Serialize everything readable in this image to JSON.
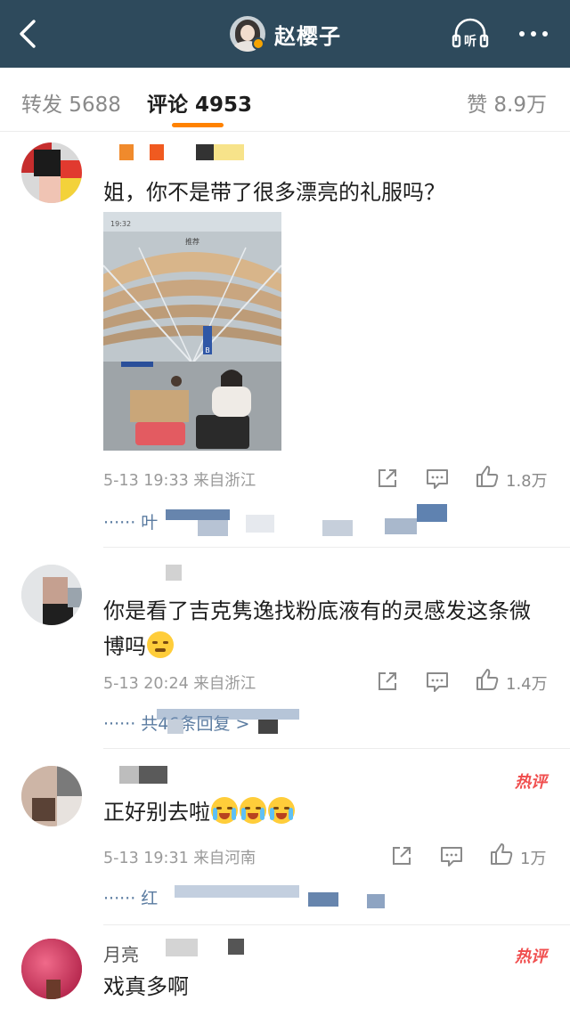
{
  "header": {
    "title": "赵樱子",
    "back_icon": "chevron-left-icon",
    "listen_label": "听",
    "more_icon": "more-dots-icon",
    "bg_color": "#2e4a5c"
  },
  "tabs": {
    "repost": "转发 5688",
    "comment": "评论 4953",
    "like": "赞 8.9万",
    "accent_color": "#ff8200"
  },
  "comments": [
    {
      "name": "",
      "text": "姐，你不是带了很多漂亮的礼服吗？",
      "meta": "5-13 19:33  来自浙江",
      "likes": "1.8万",
      "reply": "······  叶",
      "photo_status_time": "19:32",
      "photo_tab": "推荐",
      "photo_sign": "B"
    },
    {
      "name": "",
      "text": "你是看了吉克隽逸找粉底液有的灵感发这条微博吗",
      "meta": "5-13 20:24  来自浙江",
      "likes": "1.4万",
      "reply": "······  共46条回复 >"
    },
    {
      "name": "",
      "text": "正好别去啦",
      "meta": "5-13 19:31  来自河南",
      "likes": "1万",
      "reply": "······  红",
      "badge": "热评"
    },
    {
      "name": "月亮",
      "text": "戏真多啊",
      "badge": "热评"
    }
  ]
}
